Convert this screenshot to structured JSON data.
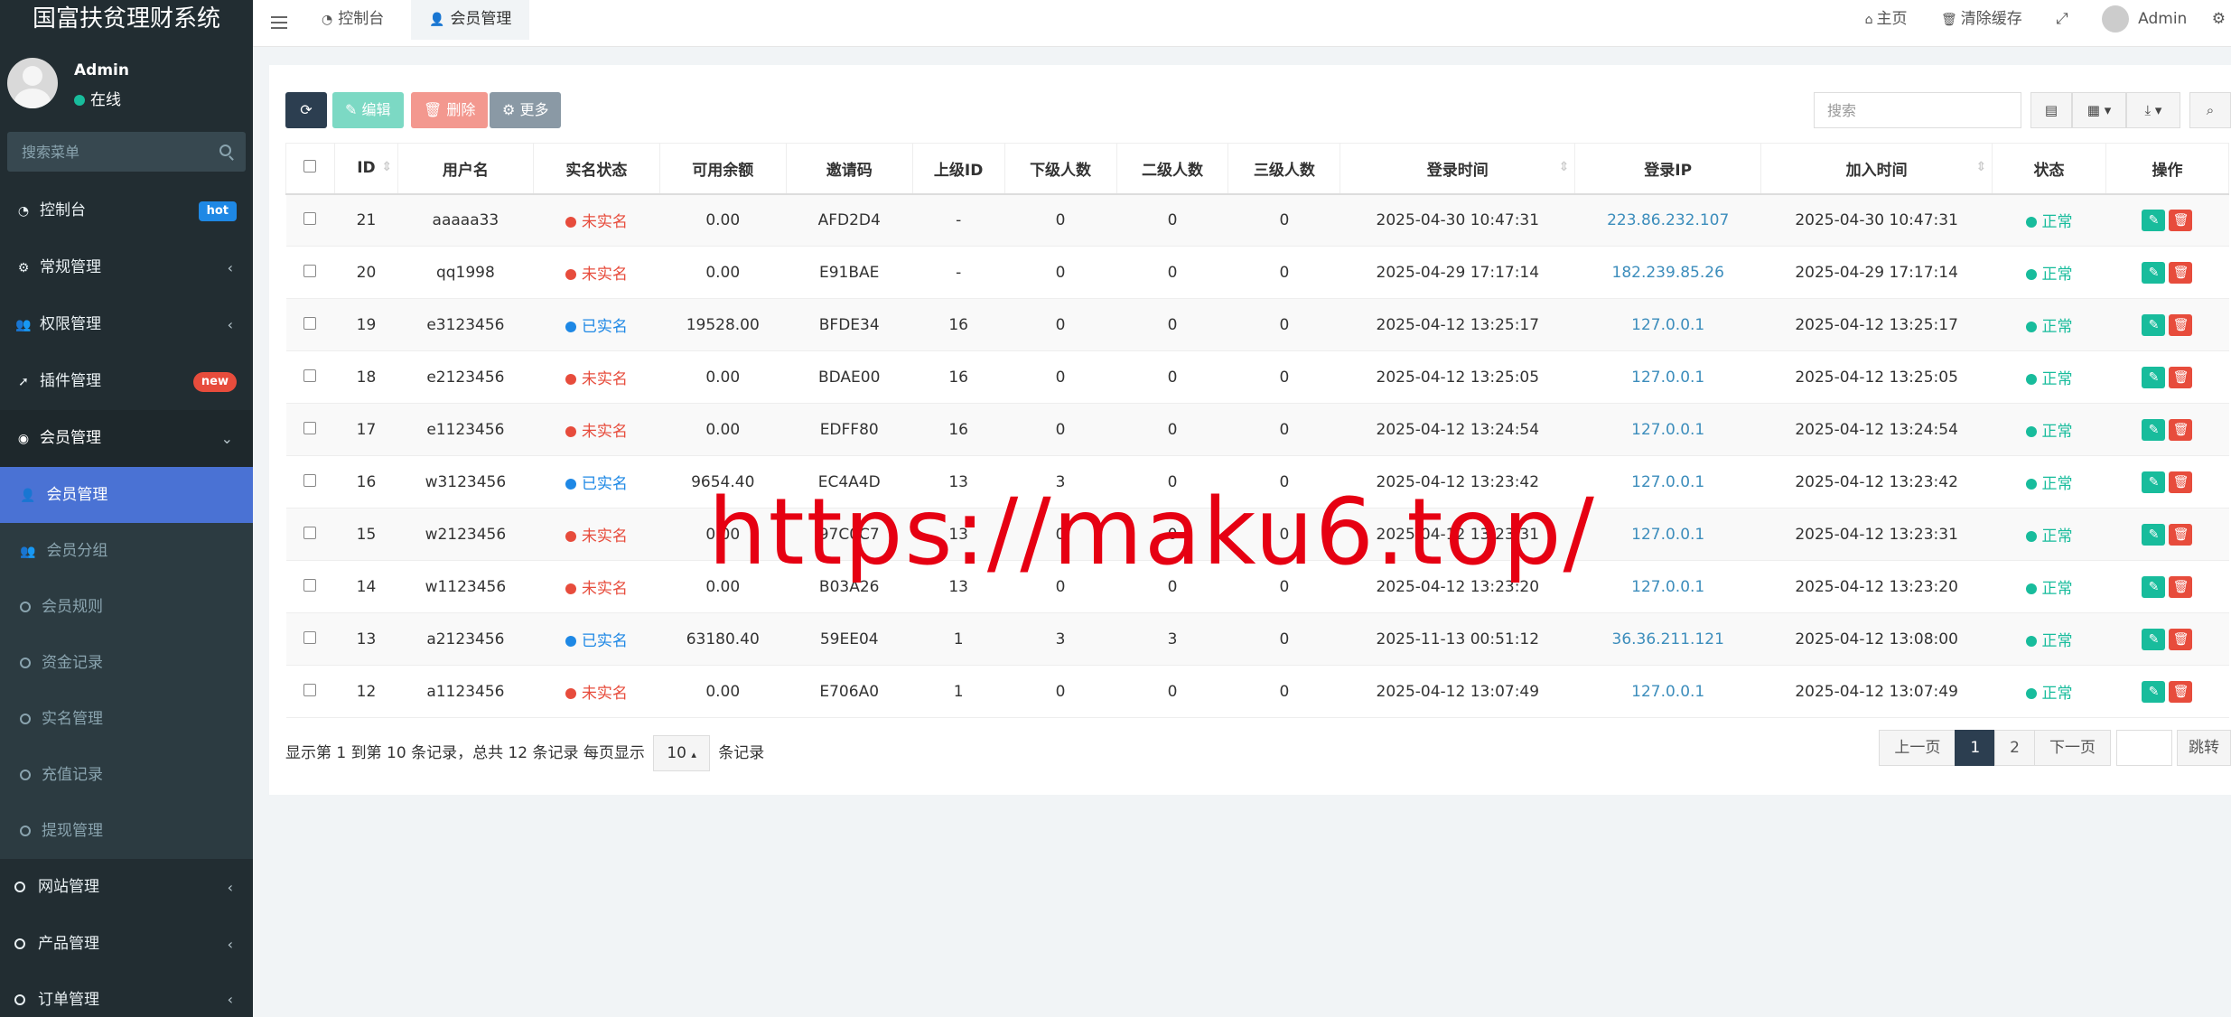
{
  "app": {
    "title": "国富扶贫理财系统"
  },
  "user": {
    "name": "Admin",
    "status": "在线"
  },
  "sidebar": {
    "search_placeholder": "搜索菜单",
    "items": [
      {
        "label": "控制台",
        "badge": "hot"
      },
      {
        "label": "常规管理"
      },
      {
        "label": "权限管理"
      },
      {
        "label": "插件管理",
        "badge": "new"
      },
      {
        "label": "会员管理"
      }
    ],
    "submenu": [
      {
        "label": "会员管理"
      },
      {
        "label": "会员分组"
      },
      {
        "label": "会员规则"
      },
      {
        "label": "资金记录"
      },
      {
        "label": "实名管理"
      },
      {
        "label": "充值记录"
      },
      {
        "label": "提现管理"
      }
    ],
    "bottom_items": [
      {
        "label": "网站管理"
      },
      {
        "label": "产品管理"
      },
      {
        "label": "订单管理"
      }
    ]
  },
  "header": {
    "tabs": [
      {
        "label": "控制台"
      },
      {
        "label": "会员管理"
      }
    ],
    "home": "主页",
    "clear_cache": "清除缓存",
    "user": "Admin"
  },
  "toolbar": {
    "edit": "编辑",
    "delete": "删除",
    "more": "更多",
    "search_placeholder": "搜索"
  },
  "table": {
    "columns": [
      "ID",
      "用户名",
      "实名状态",
      "可用余额",
      "邀请码",
      "上级ID",
      "下级人数",
      "二级人数",
      "三级人数",
      "登录时间",
      "登录IP",
      "加入时间",
      "状态",
      "操作"
    ],
    "rows": [
      {
        "id": "21",
        "username": "aaaaa33",
        "realname": "未实名",
        "verified": false,
        "balance": "0.00",
        "code": "AFD2D4",
        "parent": "-",
        "sub": "0",
        "l2": "0",
        "l3": "0",
        "login_time": "2025-04-30 10:47:31",
        "ip": "223.86.232.107",
        "join_time": "2025-04-30 10:47:31",
        "status": "正常"
      },
      {
        "id": "20",
        "username": "qq1998",
        "realname": "未实名",
        "verified": false,
        "balance": "0.00",
        "code": "E91BAE",
        "parent": "-",
        "sub": "0",
        "l2": "0",
        "l3": "0",
        "login_time": "2025-04-29 17:17:14",
        "ip": "182.239.85.26",
        "join_time": "2025-04-29 17:17:14",
        "status": "正常"
      },
      {
        "id": "19",
        "username": "e3123456",
        "realname": "已实名",
        "verified": true,
        "balance": "19528.00",
        "code": "BFDE34",
        "parent": "16",
        "sub": "0",
        "l2": "0",
        "l3": "0",
        "login_time": "2025-04-12 13:25:17",
        "ip": "127.0.0.1",
        "join_time": "2025-04-12 13:25:17",
        "status": "正常"
      },
      {
        "id": "18",
        "username": "e2123456",
        "realname": "未实名",
        "verified": false,
        "balance": "0.00",
        "code": "BDAE00",
        "parent": "16",
        "sub": "0",
        "l2": "0",
        "l3": "0",
        "login_time": "2025-04-12 13:25:05",
        "ip": "127.0.0.1",
        "join_time": "2025-04-12 13:25:05",
        "status": "正常"
      },
      {
        "id": "17",
        "username": "e1123456",
        "realname": "未实名",
        "verified": false,
        "balance": "0.00",
        "code": "EDFF80",
        "parent": "16",
        "sub": "0",
        "l2": "0",
        "l3": "0",
        "login_time": "2025-04-12 13:24:54",
        "ip": "127.0.0.1",
        "join_time": "2025-04-12 13:24:54",
        "status": "正常"
      },
      {
        "id": "16",
        "username": "w3123456",
        "realname": "已实名",
        "verified": true,
        "balance": "9654.40",
        "code": "EC4A4D",
        "parent": "13",
        "sub": "3",
        "l2": "0",
        "l3": "0",
        "login_time": "2025-04-12 13:23:42",
        "ip": "127.0.0.1",
        "join_time": "2025-04-12 13:23:42",
        "status": "正常"
      },
      {
        "id": "15",
        "username": "w2123456",
        "realname": "未实名",
        "verified": false,
        "balance": "0.00",
        "code": "97C0C7",
        "parent": "13",
        "sub": "0",
        "l2": "0",
        "l3": "0",
        "login_time": "2025-04-12 13:23:31",
        "ip": "127.0.0.1",
        "join_time": "2025-04-12 13:23:31",
        "status": "正常"
      },
      {
        "id": "14",
        "username": "w1123456",
        "realname": "未实名",
        "verified": false,
        "balance": "0.00",
        "code": "B03A26",
        "parent": "13",
        "sub": "0",
        "l2": "0",
        "l3": "0",
        "login_time": "2025-04-12 13:23:20",
        "ip": "127.0.0.1",
        "join_time": "2025-04-12 13:23:20",
        "status": "正常"
      },
      {
        "id": "13",
        "username": "a2123456",
        "realname": "已实名",
        "verified": true,
        "balance": "63180.40",
        "code": "59EE04",
        "parent": "1",
        "sub": "3",
        "l2": "3",
        "l3": "0",
        "login_time": "2025-11-13 00:51:12",
        "ip": "36.36.211.121",
        "join_time": "2025-04-12 13:08:00",
        "status": "正常"
      },
      {
        "id": "12",
        "username": "a1123456",
        "realname": "未实名",
        "verified": false,
        "balance": "0.00",
        "code": "E706A0",
        "parent": "1",
        "sub": "0",
        "l2": "0",
        "l3": "0",
        "login_time": "2025-04-12 13:07:49",
        "ip": "127.0.0.1",
        "join_time": "2025-04-12 13:07:49",
        "status": "正常"
      }
    ]
  },
  "footer": {
    "info_prefix": "显示第 1 到第 10 条记录，总共 12 条记录 每页显示",
    "page_size": "10",
    "info_suffix": "条记录",
    "prev": "上一页",
    "pages": [
      "1",
      "2"
    ],
    "next": "下一页",
    "jump": "跳转"
  },
  "watermark": "https://maku6.top/"
}
